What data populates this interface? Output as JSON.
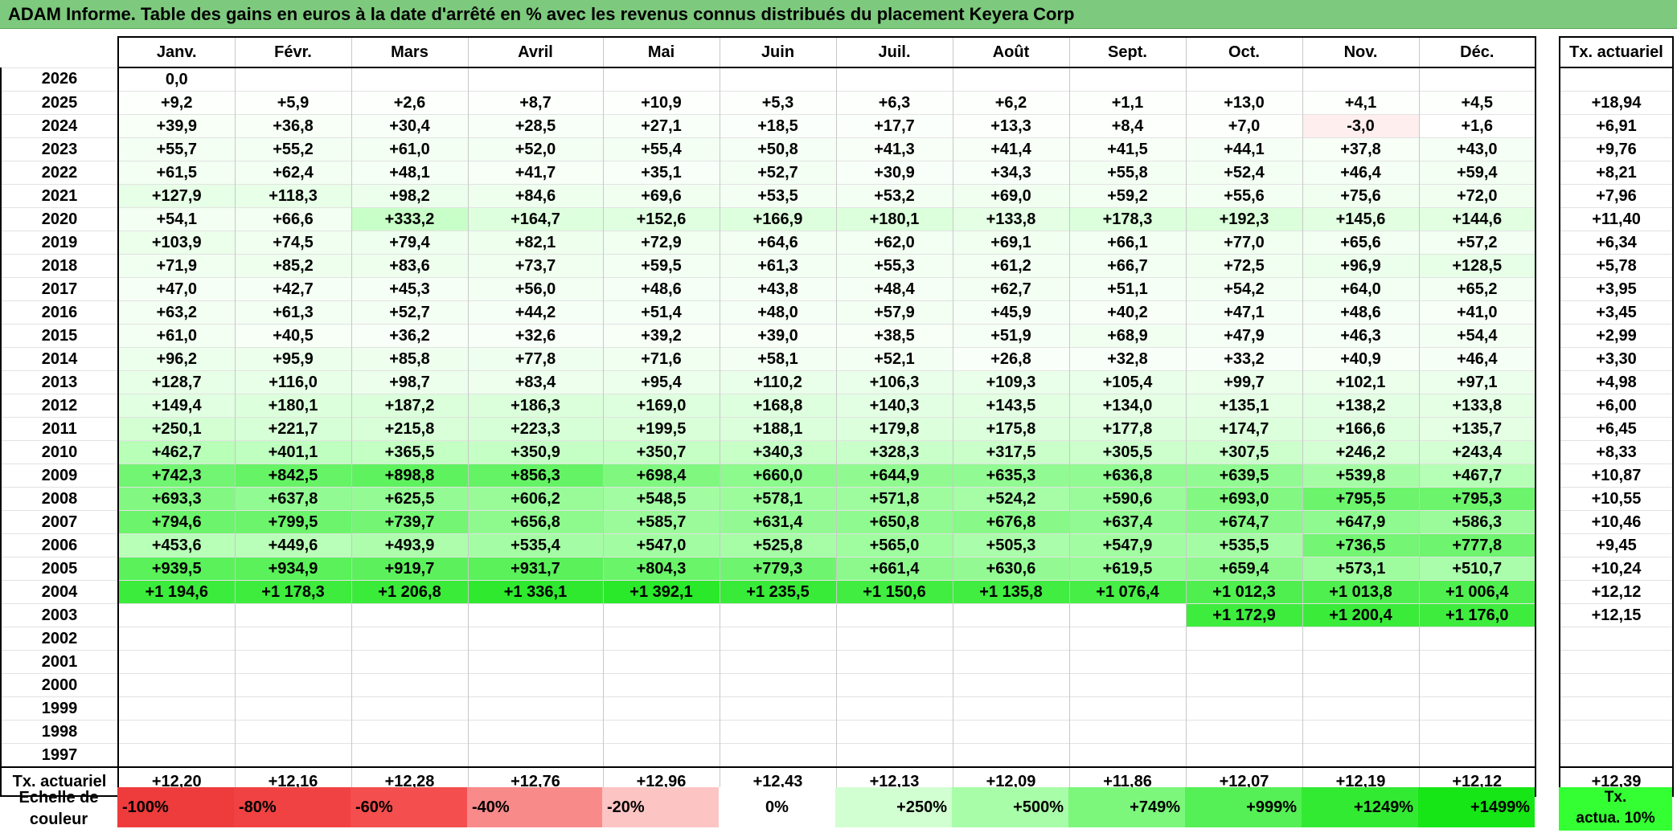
{
  "title": "ADAM Informe. Table des gains en euros à la date d'arrêté en % avec les revenus connus distribués du placement Keyera Corp",
  "months": [
    "Janv.",
    "Févr.",
    "Mars",
    "Avril",
    "Mai",
    "Juin",
    "Juil.",
    "Août",
    "Sept.",
    "Oct.",
    "Nov.",
    "Déc."
  ],
  "tx_header": "Tx. actuariel",
  "rows": [
    {
      "year": "2026",
      "values": [
        "0,0",
        "",
        "",
        "",
        "",
        "",
        "",
        "",
        "",
        "",
        "",
        ""
      ],
      "colors": [
        "#ffffff",
        "#ffffff",
        "#ffffff",
        "#ffffff",
        "#ffffff",
        "#ffffff",
        "#ffffff",
        "#ffffff",
        "#ffffff",
        "#ffffff",
        "#ffffff",
        "#ffffff"
      ],
      "tx": ""
    },
    {
      "year": "2025",
      "values": [
        "+9,2",
        "+5,9",
        "+2,6",
        "+8,7",
        "+10,9",
        "+5,3",
        "+6,3",
        "+6,2",
        "+1,1",
        "+13,0",
        "+4,1",
        "+4,5"
      ],
      "colors": [
        "#fdfffd",
        "#fdfffd",
        "#fdfffd",
        "#fdfffd",
        "#fdfffd",
        "#fdfffd",
        "#fdfffd",
        "#fdfffd",
        "#fdfffd",
        "#fdfffd",
        "#fdfffd",
        "#fdfffd"
      ],
      "tx": "+18,94"
    },
    {
      "year": "2024",
      "values": [
        "+39,9",
        "+36,8",
        "+30,4",
        "+28,5",
        "+27,1",
        "+18,5",
        "+17,7",
        "+13,3",
        "+8,4",
        "+7,0",
        "-3,0",
        "+1,6"
      ],
      "colors": [
        "#f7fff7",
        "#f7fff7",
        "#f8fff8",
        "#f8fff8",
        "#f8fff8",
        "#fbfffb",
        "#fbfffb",
        "#fcfffc",
        "#fdfffd",
        "#fdfffd",
        "#ffeeee",
        "#ffffff"
      ],
      "tx": "+6,91"
    },
    {
      "year": "2023",
      "values": [
        "+55,7",
        "+55,2",
        "+61,0",
        "+52,0",
        "+55,4",
        "+50,8",
        "+41,3",
        "+41,4",
        "+41,5",
        "+44,1",
        "+37,8",
        "+43,0"
      ],
      "colors": [
        "#f4fff4",
        "#f4fff4",
        "#f3fff3",
        "#f4fff4",
        "#f4fff4",
        "#f5fff5",
        "#f7fff7",
        "#f7fff7",
        "#f7fff7",
        "#f6fff6",
        "#f7fff7",
        "#f6fff6"
      ],
      "tx": "+9,76"
    },
    {
      "year": "2022",
      "values": [
        "+61,5",
        "+62,4",
        "+48,1",
        "+41,7",
        "+35,1",
        "+52,7",
        "+30,9",
        "+34,3",
        "+55,8",
        "+52,4",
        "+46,4",
        "+59,4"
      ],
      "colors": [
        "#f3fff3",
        "#f3fff3",
        "#f5fff5",
        "#f7fff7",
        "#f8fff8",
        "#f4fff4",
        "#f8fff8",
        "#f8fff8",
        "#f4fff4",
        "#f4fff4",
        "#f5fff5",
        "#f3fff3"
      ],
      "tx": "+8,21"
    },
    {
      "year": "2021",
      "values": [
        "+127,9",
        "+118,3",
        "+98,2",
        "+84,6",
        "+69,6",
        "+53,5",
        "+53,2",
        "+69,0",
        "+59,2",
        "+55,6",
        "+75,6",
        "+72,0"
      ],
      "colors": [
        "#e6ffe6",
        "#e8ffe8",
        "#ecffec",
        "#eeffee",
        "#f1fff1",
        "#f4fff4",
        "#f4fff4",
        "#f1fff1",
        "#f3fff3",
        "#f4fff4",
        "#f0fff0",
        "#f1fff1"
      ],
      "tx": "+7,96"
    },
    {
      "year": "2020",
      "values": [
        "+54,1",
        "+66,6",
        "+333,2",
        "+164,7",
        "+152,6",
        "+166,9",
        "+180,1",
        "+133,8",
        "+178,3",
        "+192,3",
        "+145,6",
        "+144,6"
      ],
      "colors": [
        "#f4fff4",
        "#f2fff2",
        "#c8ffc8",
        "#deffde",
        "#e0ffe0",
        "#deffde",
        "#dcffdc",
        "#e4ffe4",
        "#dcffdc",
        "#daffda",
        "#e2ffe2",
        "#e2ffe2"
      ],
      "tx": "+11,40"
    },
    {
      "year": "2019",
      "values": [
        "+103,9",
        "+74,5",
        "+79,4",
        "+82,1",
        "+72,9",
        "+64,6",
        "+62,0",
        "+69,1",
        "+66,1",
        "+77,0",
        "+65,6",
        "+57,2"
      ],
      "colors": [
        "#ebffeb",
        "#f0fff0",
        "#efffef",
        "#eeffee",
        "#f0fff0",
        "#f2fff2",
        "#f3fff3",
        "#f1fff1",
        "#f2fff2",
        "#f0fff0",
        "#f2fff2",
        "#f3fff3"
      ],
      "tx": "+6,34"
    },
    {
      "year": "2018",
      "values": [
        "+71,9",
        "+85,2",
        "+83,6",
        "+73,7",
        "+59,5",
        "+61,3",
        "+55,3",
        "+61,2",
        "+66,7",
        "+72,5",
        "+96,9",
        "+128,5"
      ],
      "colors": [
        "#f1fff1",
        "#eeffee",
        "#eeffee",
        "#f0fff0",
        "#f3fff3",
        "#f3fff3",
        "#f4fff4",
        "#f3fff3",
        "#f2fff2",
        "#f1fff1",
        "#ecffec",
        "#e6ffe6"
      ],
      "tx": "+5,78"
    },
    {
      "year": "2017",
      "values": [
        "+47,0",
        "+42,7",
        "+45,3",
        "+56,0",
        "+48,6",
        "+43,8",
        "+48,4",
        "+62,7",
        "+51,1",
        "+54,2",
        "+64,0",
        "+65,2"
      ],
      "colors": [
        "#f6fff6",
        "#f6fff6",
        "#f6fff6",
        "#f4fff4",
        "#f5fff5",
        "#f6fff6",
        "#f5fff5",
        "#f3fff3",
        "#f5fff5",
        "#f4fff4",
        "#f2fff2",
        "#f2fff2"
      ],
      "tx": "+3,95"
    },
    {
      "year": "2016",
      "values": [
        "+63,2",
        "+61,3",
        "+52,7",
        "+44,2",
        "+51,4",
        "+48,0",
        "+57,9",
        "+45,9",
        "+40,2",
        "+47,1",
        "+48,6",
        "+41,0"
      ],
      "colors": [
        "#f3fff3",
        "#f3fff3",
        "#f4fff4",
        "#f6fff6",
        "#f5fff5",
        "#f5fff5",
        "#f3fff3",
        "#f6fff6",
        "#f7fff7",
        "#f6fff6",
        "#f5fff5",
        "#f7fff7"
      ],
      "tx": "+3,45"
    },
    {
      "year": "2015",
      "values": [
        "+61,0",
        "+40,5",
        "+36,2",
        "+32,6",
        "+39,2",
        "+39,0",
        "+38,5",
        "+51,9",
        "+68,9",
        "+47,9",
        "+46,3",
        "+54,4"
      ],
      "colors": [
        "#f3fff3",
        "#f7fff7",
        "#f8fff8",
        "#f8fff8",
        "#f7fff7",
        "#f7fff7",
        "#f7fff7",
        "#f5fff5",
        "#f1fff1",
        "#f5fff5",
        "#f6fff6",
        "#f4fff4"
      ],
      "tx": "+2,99"
    },
    {
      "year": "2014",
      "values": [
        "+96,2",
        "+95,9",
        "+85,8",
        "+77,8",
        "+71,6",
        "+58,1",
        "+52,1",
        "+26,8",
        "+32,8",
        "+33,2",
        "+40,9",
        "+46,4"
      ],
      "colors": [
        "#ecffec",
        "#ecffec",
        "#eeffee",
        "#efffef",
        "#f1fff1",
        "#f3fff3",
        "#f4fff4",
        "#f9fff9",
        "#f8fff8",
        "#f8fff8",
        "#f7fff7",
        "#f6fff6"
      ],
      "tx": "+3,30"
    },
    {
      "year": "2013",
      "values": [
        "+128,7",
        "+116,0",
        "+98,7",
        "+83,4",
        "+95,4",
        "+110,2",
        "+106,3",
        "+109,3",
        "+105,4",
        "+99,7",
        "+102,1",
        "+97,1"
      ],
      "colors": [
        "#e6ffe6",
        "#e8ffe8",
        "#ecffec",
        "#eeffee",
        "#ecffec",
        "#e9ffe9",
        "#eaffea",
        "#e9ffe9",
        "#eaffea",
        "#ebffeb",
        "#ebffeb",
        "#ecffec"
      ],
      "tx": "+4,98"
    },
    {
      "year": "2012",
      "values": [
        "+149,4",
        "+180,1",
        "+187,2",
        "+186,3",
        "+169,0",
        "+168,8",
        "+140,3",
        "+143,5",
        "+134,0",
        "+135,1",
        "+138,2",
        "+133,8"
      ],
      "colors": [
        "#e1ffe1",
        "#dcffdc",
        "#daffda",
        "#daffda",
        "#ddffdd",
        "#ddffdd",
        "#e3ffe3",
        "#e2ffe2",
        "#e4ffe4",
        "#e4ffe4",
        "#e3ffe3",
        "#e4ffe4"
      ],
      "tx": "+6,00"
    },
    {
      "year": "2011",
      "values": [
        "+250,1",
        "+221,7",
        "+215,8",
        "+223,3",
        "+199,5",
        "+188,1",
        "+179,8",
        "+175,8",
        "+177,8",
        "+174,7",
        "+166,6",
        "+135,7"
      ],
      "colors": [
        "#d3ffd3",
        "#d7ffd7",
        "#d8ffd8",
        "#d7ffd7",
        "#d9ffd9",
        "#daffda",
        "#dcffdc",
        "#dcffdc",
        "#dcffdc",
        "#dcffdc",
        "#deffde",
        "#e4ffe4"
      ],
      "tx": "+6,45"
    },
    {
      "year": "2010",
      "values": [
        "+462,7",
        "+401,1",
        "+365,5",
        "+350,9",
        "+350,7",
        "+340,3",
        "+328,3",
        "+317,5",
        "+305,5",
        "+307,5",
        "+246,2",
        "+243,4"
      ],
      "colors": [
        "#b8ffb8",
        "#bfffbf",
        "#c4ffc4",
        "#c6ffc6",
        "#c6ffc6",
        "#c7ffc7",
        "#c9ffc9",
        "#caffca",
        "#ccffcc",
        "#ccffcc",
        "#d4ffd4",
        "#d4ffd4"
      ],
      "tx": "+8,33"
    },
    {
      "year": "2009",
      "values": [
        "+742,3",
        "+842,5",
        "+898,8",
        "+856,3",
        "+698,4",
        "+660,0",
        "+644,9",
        "+635,3",
        "+636,8",
        "+639,5",
        "+539,8",
        "+467,7"
      ],
      "colors": [
        "#72f572",
        "#66f366",
        "#5ff25f",
        "#64f364",
        "#80f880",
        "#8cfa8c",
        "#90fa90",
        "#92fa92",
        "#92fa92",
        "#92fa92",
        "#a4fda4",
        "#b6ffb6"
      ],
      "tx": "+10,87"
    },
    {
      "year": "2008",
      "values": [
        "+693,3",
        "+637,8",
        "+625,5",
        "+606,2",
        "+548,5",
        "+578,1",
        "+571,8",
        "+524,2",
        "+590,6",
        "+693,0",
        "+795,5",
        "+795,3"
      ],
      "colors": [
        "#82f882",
        "#92fa92",
        "#94fb94",
        "#98fb98",
        "#a2fca2",
        "#9cfc9c",
        "#9efc9e",
        "#a6fda6",
        "#9afb9a",
        "#82f882",
        "#6cf46c",
        "#6cf46c"
      ],
      "tx": "+10,55"
    },
    {
      "year": "2007",
      "values": [
        "+794,6",
        "+799,5",
        "+739,7",
        "+656,8",
        "+585,7",
        "+631,4",
        "+650,8",
        "+676,8",
        "+637,4",
        "+674,7",
        "+647,9",
        "+586,3"
      ],
      "colors": [
        "#6cf46c",
        "#6cf46c",
        "#74f574",
        "#8efa8e",
        "#9bfb9b",
        "#93fa93",
        "#8ffa8f",
        "#88f988",
        "#92fa92",
        "#88f988",
        "#8ffa8f",
        "#9bfb9b"
      ],
      "tx": "+10,46"
    },
    {
      "year": "2006",
      "values": [
        "+453,6",
        "+449,6",
        "+493,9",
        "+535,4",
        "+547,0",
        "+525,8",
        "+565,0",
        "+505,3",
        "+547,9",
        "+535,5",
        "+736,5",
        "+777,8"
      ],
      "colors": [
        "#b8ffb8",
        "#b9ffb9",
        "#adfdad",
        "#a4fda4",
        "#a2fca2",
        "#a6fda6",
        "#9ffc9f",
        "#aafdaa",
        "#a2fca2",
        "#a4fda4",
        "#74f574",
        "#6ef46e"
      ],
      "tx": "+9,45"
    },
    {
      "year": "2005",
      "values": [
        "+939,5",
        "+934,9",
        "+919,7",
        "+931,7",
        "+804,3",
        "+779,3",
        "+661,4",
        "+630,6",
        "+619,5",
        "+659,4",
        "+573,1",
        "+510,7"
      ],
      "colors": [
        "#5af15a",
        "#5af15a",
        "#5cf15c",
        "#5af15a",
        "#6af46a",
        "#6ef46e",
        "#8df98d",
        "#93fa93",
        "#95fb95",
        "#8df98d",
        "#9efc9e",
        "#aafdaa"
      ],
      "tx": "+10,24"
    },
    {
      "year": "2004",
      "values": [
        "+1 194,6",
        "+1 178,3",
        "+1 206,8",
        "+1 336,1",
        "+1 392,1",
        "+1 235,5",
        "+1 150,6",
        "+1 135,8",
        "+1 076,4",
        "+1 012,3",
        "+1 013,8",
        "+1 006,4"
      ],
      "colors": [
        "#3cec3c",
        "#3eec3e",
        "#3aeb3a",
        "#2ee92e",
        "#2ae82a",
        "#38eb38",
        "#40ed40",
        "#40ed40",
        "#46ee46",
        "#50ef50",
        "#50ef50",
        "#50ef50"
      ],
      "tx": "+12,12"
    },
    {
      "year": "2003",
      "values": [
        "",
        "",
        "",
        "",
        "",
        "",
        "",
        "",
        "",
        "+1 172,9",
        "+1 200,4",
        "+1 176,0"
      ],
      "colors": [
        "#ffffff",
        "#ffffff",
        "#ffffff",
        "#ffffff",
        "#ffffff",
        "#ffffff",
        "#ffffff",
        "#ffffff",
        "#ffffff",
        "#3eec3e",
        "#3aeb3a",
        "#3eec3e"
      ],
      "tx": "+12,15"
    },
    {
      "year": "2002",
      "values": [
        "",
        "",
        "",
        "",
        "",
        "",
        "",
        "",
        "",
        "",
        "",
        ""
      ],
      "colors": [
        "#ffffff",
        "#ffffff",
        "#ffffff",
        "#ffffff",
        "#ffffff",
        "#ffffff",
        "#ffffff",
        "#ffffff",
        "#ffffff",
        "#ffffff",
        "#ffffff",
        "#ffffff"
      ],
      "tx": ""
    },
    {
      "year": "2001",
      "values": [
        "",
        "",
        "",
        "",
        "",
        "",
        "",
        "",
        "",
        "",
        "",
        ""
      ],
      "colors": [
        "#ffffff",
        "#ffffff",
        "#ffffff",
        "#ffffff",
        "#ffffff",
        "#ffffff",
        "#ffffff",
        "#ffffff",
        "#ffffff",
        "#ffffff",
        "#ffffff",
        "#ffffff"
      ],
      "tx": ""
    },
    {
      "year": "2000",
      "values": [
        "",
        "",
        "",
        "",
        "",
        "",
        "",
        "",
        "",
        "",
        "",
        ""
      ],
      "colors": [
        "#ffffff",
        "#ffffff",
        "#ffffff",
        "#ffffff",
        "#ffffff",
        "#ffffff",
        "#ffffff",
        "#ffffff",
        "#ffffff",
        "#ffffff",
        "#ffffff",
        "#ffffff"
      ],
      "tx": ""
    },
    {
      "year": "1999",
      "values": [
        "",
        "",
        "",
        "",
        "",
        "",
        "",
        "",
        "",
        "",
        "",
        ""
      ],
      "colors": [
        "#ffffff",
        "#ffffff",
        "#ffffff",
        "#ffffff",
        "#ffffff",
        "#ffffff",
        "#ffffff",
        "#ffffff",
        "#ffffff",
        "#ffffff",
        "#ffffff",
        "#ffffff"
      ],
      "tx": ""
    },
    {
      "year": "1998",
      "values": [
        "",
        "",
        "",
        "",
        "",
        "",
        "",
        "",
        "",
        "",
        "",
        ""
      ],
      "colors": [
        "#ffffff",
        "#ffffff",
        "#ffffff",
        "#ffffff",
        "#ffffff",
        "#ffffff",
        "#ffffff",
        "#ffffff",
        "#ffffff",
        "#ffffff",
        "#ffffff",
        "#ffffff"
      ],
      "tx": ""
    },
    {
      "year": "1997",
      "values": [
        "",
        "",
        "",
        "",
        "",
        "",
        "",
        "",
        "",
        "",
        "",
        ""
      ],
      "colors": [
        "#ffffff",
        "#ffffff",
        "#ffffff",
        "#ffffff",
        "#ffffff",
        "#ffffff",
        "#ffffff",
        "#ffffff",
        "#ffffff",
        "#ffffff",
        "#ffffff",
        "#ffffff"
      ],
      "tx": ""
    }
  ],
  "total_row": {
    "label": "Tx. actuariel",
    "values": [
      "+12,20",
      "+12,16",
      "+12,28",
      "+12,76",
      "+12,96",
      "+12,43",
      "+12,13",
      "+12,09",
      "+11,86",
      "+12,07",
      "+12,19",
      "+12,12"
    ],
    "tx": "+12,39"
  },
  "legend": {
    "label_line1": "Echelle de",
    "label_line2": "couleur",
    "items": [
      {
        "text": "-100%",
        "color": "#ee3b3b",
        "align": "left"
      },
      {
        "text": "-80%",
        "color": "#f04242",
        "align": "left"
      },
      {
        "text": "-60%",
        "color": "#f44e4e",
        "align": "left"
      },
      {
        "text": "-40%",
        "color": "#f98a8a",
        "align": "left"
      },
      {
        "text": "-20%",
        "color": "#fdc4c4",
        "align": "left"
      },
      {
        "text": "0%",
        "color": "#ffffff",
        "align": "center"
      },
      {
        "text": "+250%",
        "color": "#d2ffd2",
        "align": "right"
      },
      {
        "text": "+500%",
        "color": "#a8fda8",
        "align": "right"
      },
      {
        "text": "+749%",
        "color": "#7cf77c",
        "align": "right"
      },
      {
        "text": "+999%",
        "color": "#55f055",
        "align": "right"
      },
      {
        "text": "+1249%",
        "color": "#33ea33",
        "align": "right"
      },
      {
        "text": "+1499%",
        "color": "#16e616",
        "align": "right"
      }
    ],
    "tx_line1": "Tx.",
    "tx_line2": "actua. 10%",
    "tx_color": "#33ff33"
  }
}
